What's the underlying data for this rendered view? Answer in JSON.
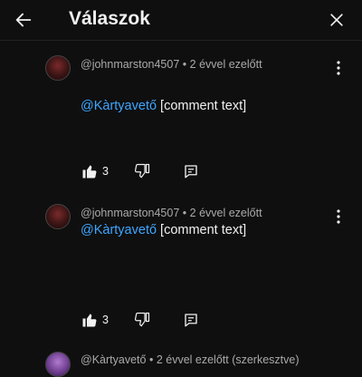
{
  "header": {
    "title": "Válaszok",
    "back_icon": "arrow-left-icon",
    "close_icon": "close-icon"
  },
  "replies": [
    {
      "author": "@johnmarston4507",
      "time": "2 évvel ezelőtt",
      "separator": "•",
      "mention": "@Kàrtyavető",
      "text": "[comment text]",
      "likes": "3"
    },
    {
      "author": "@johnmarston4507",
      "time": "2 évvel ezelőtt",
      "separator": "•",
      "mention": "@Kàrtyavető",
      "text": "[comment text]",
      "likes": "3"
    },
    {
      "author": "@Kàrtyavető",
      "time": "2 évvel ezelőtt (szerkesztve)",
      "separator": "•"
    }
  ],
  "colors": {
    "background": "#0f0f0f",
    "text": "#f1f1f1",
    "meta": "#aaaaaa",
    "mention": "#3ea6ff"
  }
}
